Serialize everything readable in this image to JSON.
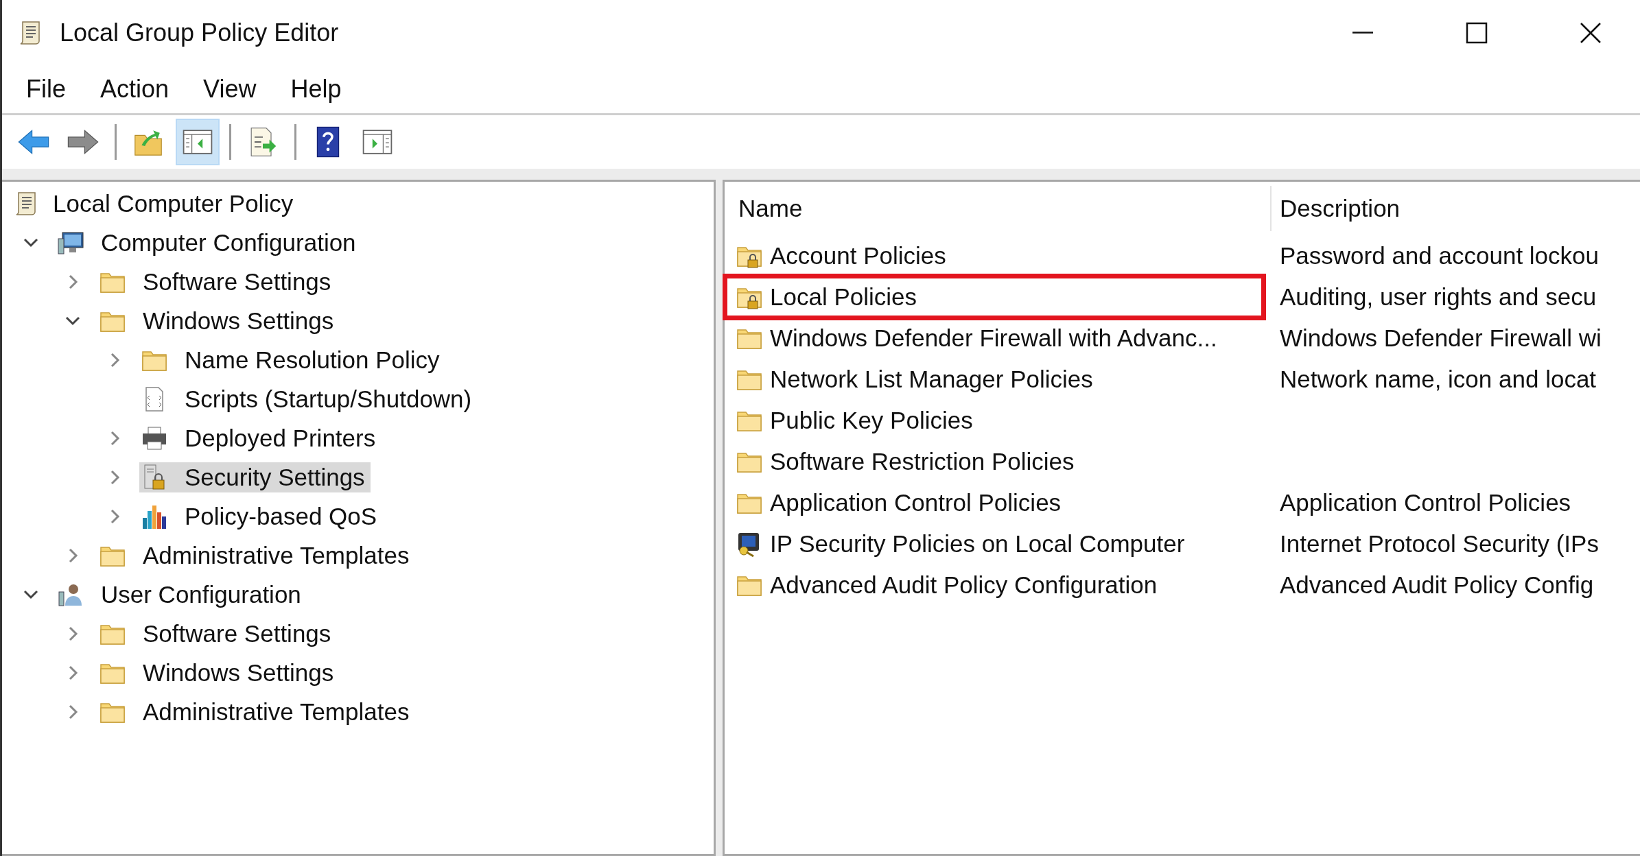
{
  "window": {
    "title": "Local Group Policy Editor"
  },
  "menu": [
    "File",
    "Action",
    "View",
    "Help"
  ],
  "toolbar": [
    {
      "kind": "back",
      "selected": false
    },
    {
      "kind": "forward",
      "selected": false
    },
    {
      "kind": "separator"
    },
    {
      "kind": "up",
      "selected": false
    },
    {
      "kind": "tree-pane",
      "selected": true
    },
    {
      "kind": "separator"
    },
    {
      "kind": "export",
      "selected": false
    },
    {
      "kind": "separator"
    },
    {
      "kind": "help",
      "selected": false
    },
    {
      "kind": "action-pane",
      "selected": false
    }
  ],
  "tree": [
    {
      "label": "Local Computer Policy",
      "kind": "scroll",
      "selected": false,
      "children": [
        {
          "label": "Computer Configuration",
          "kind": "computer",
          "expanded": true,
          "selected": false,
          "children": [
            {
              "label": "Software Settings",
              "kind": "folder",
              "expanded": false,
              "selected": false
            },
            {
              "label": "Windows Settings",
              "kind": "folder",
              "expanded": true,
              "selected": false,
              "children": [
                {
                  "label": "Name Resolution Policy",
                  "kind": "folder",
                  "expanded": false,
                  "selected": false
                },
                {
                  "label": "Scripts (Startup/Shutdown)",
                  "kind": "script",
                  "selected": false
                },
                {
                  "label": "Deployed Printers",
                  "kind": "printer",
                  "expanded": false,
                  "selected": false
                },
                {
                  "label": "Security Settings",
                  "kind": "security",
                  "expanded": false,
                  "selected": true
                },
                {
                  "label": "Policy-based QoS",
                  "kind": "chart",
                  "expanded": false,
                  "selected": false
                }
              ]
            },
            {
              "label": "Administrative Templates",
              "kind": "folder",
              "expanded": false,
              "selected": false
            }
          ]
        },
        {
          "label": "User Configuration",
          "kind": "user",
          "expanded": true,
          "selected": false,
          "children": [
            {
              "label": "Software Settings",
              "kind": "folder",
              "expanded": false,
              "selected": false
            },
            {
              "label": "Windows Settings",
              "kind": "folder",
              "expanded": false,
              "selected": false
            },
            {
              "label": "Administrative Templates",
              "kind": "folder",
              "expanded": false,
              "selected": false
            }
          ]
        }
      ]
    }
  ],
  "list": {
    "columns": [
      "Name",
      "Description"
    ],
    "rows": [
      {
        "name": "Account Policies",
        "description": "Password and account lockou",
        "kind": "locked-folder",
        "highlighted": false
      },
      {
        "name": "Local Policies",
        "description": "Auditing, user rights and secu",
        "kind": "locked-folder",
        "highlighted": true
      },
      {
        "name": "Windows Defender Firewall with Advanc...",
        "description": "Windows Defender Firewall wi",
        "kind": "folder",
        "highlighted": false
      },
      {
        "name": "Network List Manager Policies",
        "description": "Network name, icon and locat",
        "kind": "folder",
        "highlighted": false
      },
      {
        "name": "Public Key Policies",
        "kind": "folder",
        "highlighted": false
      },
      {
        "name": "Software Restriction Policies",
        "kind": "folder",
        "highlighted": false
      },
      {
        "name": "Application Control Policies",
        "description": "Application Control Policies",
        "kind": "folder",
        "highlighted": false
      },
      {
        "name": "IP Security Policies on Local Computer",
        "description": "Internet Protocol Security (IPs",
        "kind": "ip-security",
        "highlighted": false
      },
      {
        "name": "Advanced Audit Policy Configuration",
        "description": "Advanced Audit Policy Config",
        "kind": "folder",
        "highlighted": false
      }
    ]
  }
}
